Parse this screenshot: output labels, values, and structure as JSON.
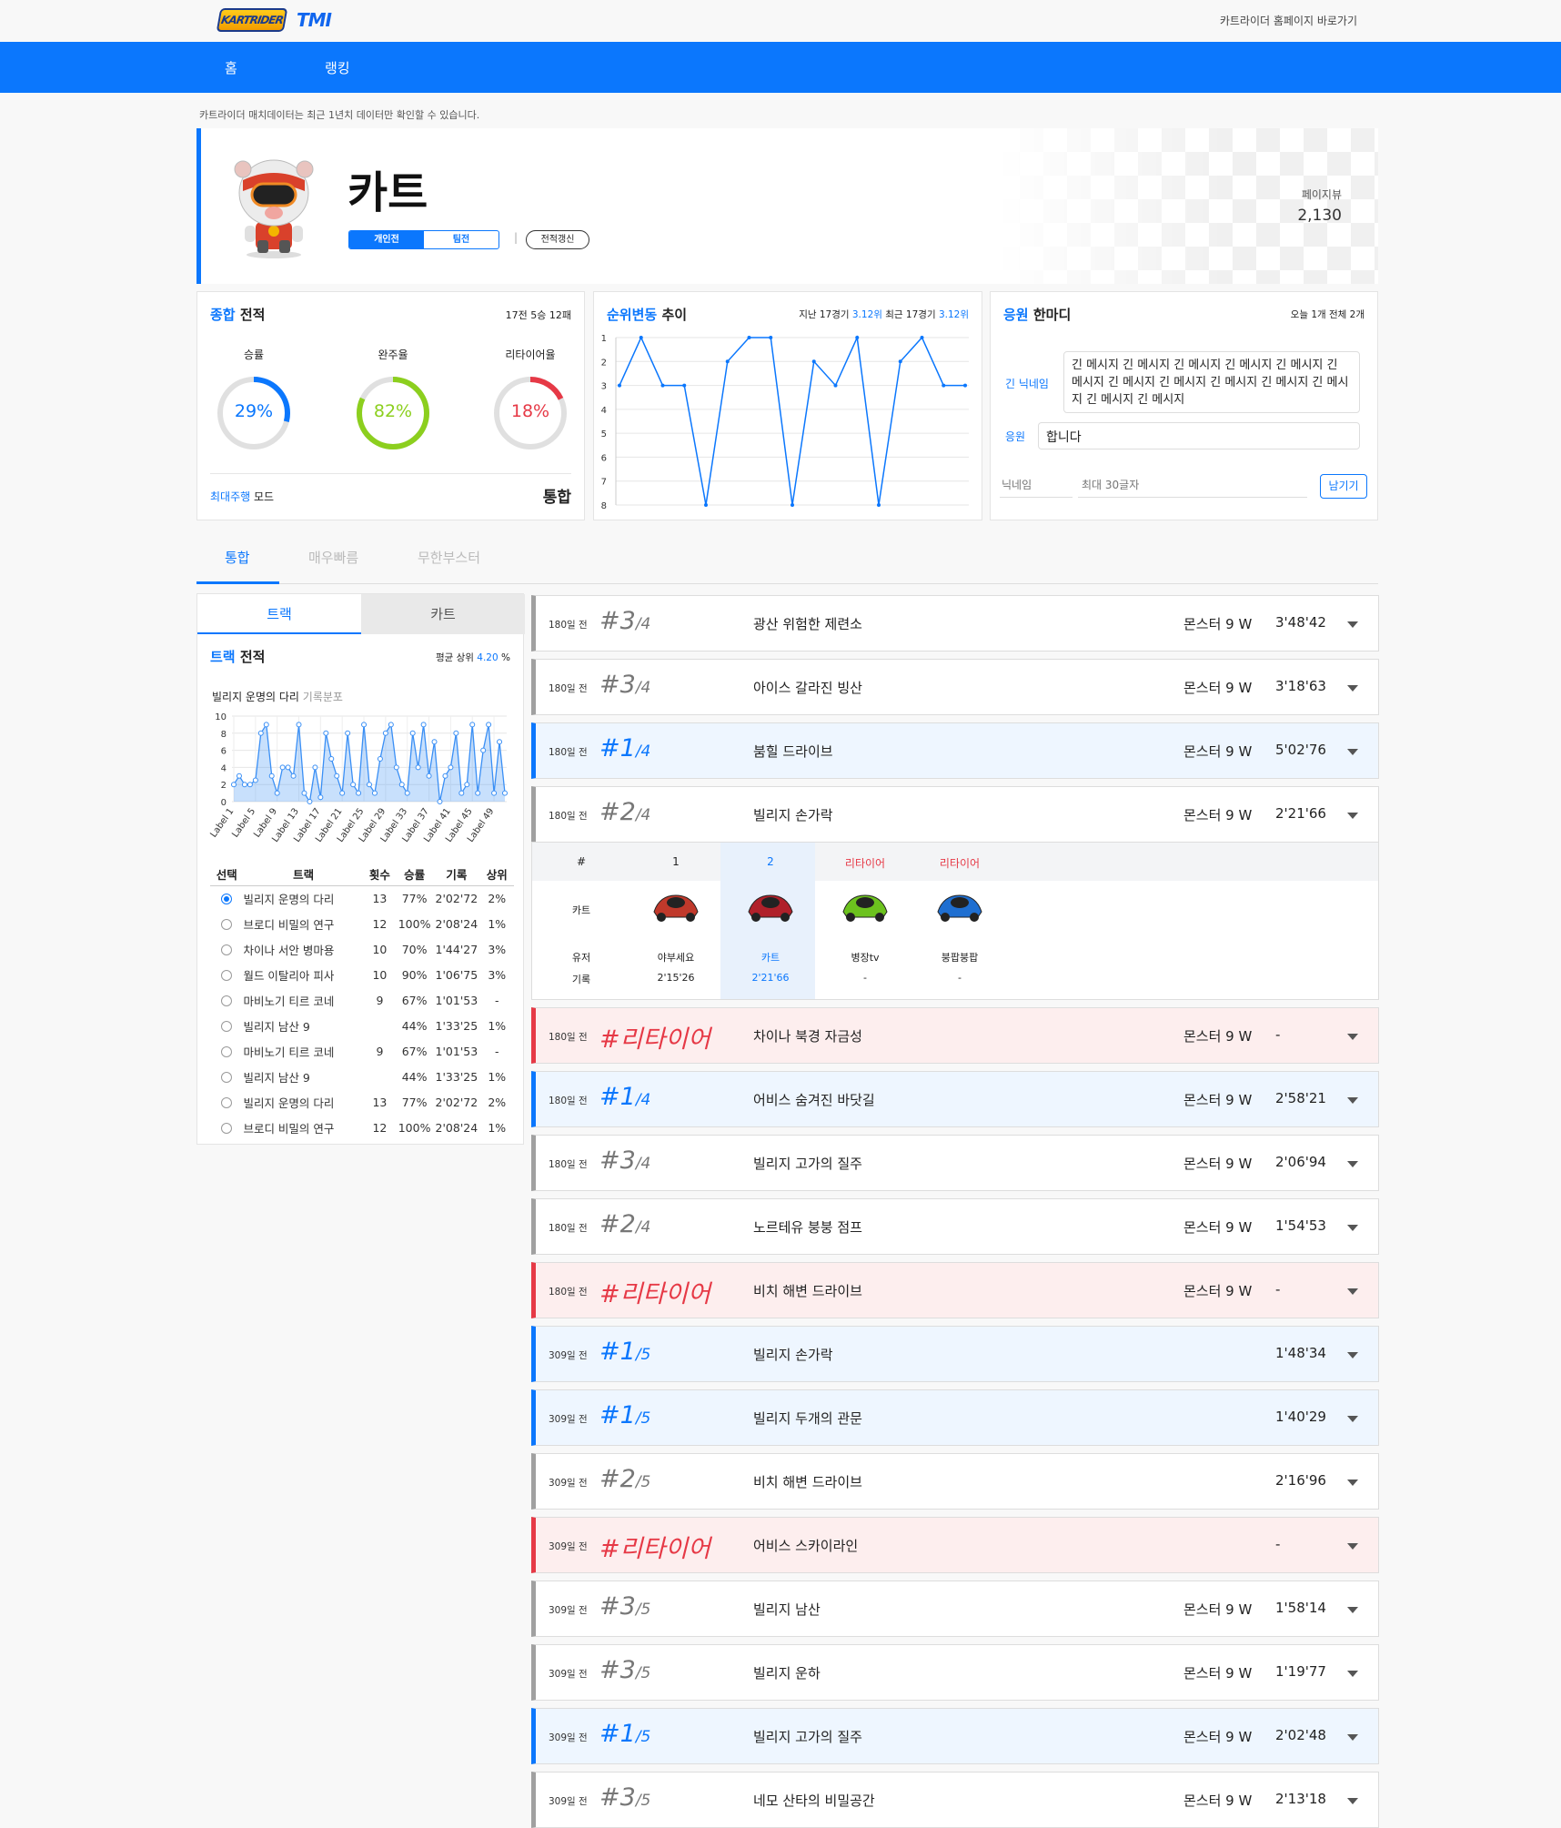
{
  "header": {
    "logo_brand": "KARTRIDER",
    "logo_tmi": "TMI",
    "home_link": "카트라이더 홈페이지 바로가기"
  },
  "nav": {
    "items": [
      "홈",
      "랭킹"
    ]
  },
  "notice": "카트라이더 매치데이터는 최근 1년치 데이터만 확인할 수 있습니다.",
  "profile": {
    "name": "카트",
    "mode_tabs": [
      "개인전",
      "팀전"
    ],
    "active_mode": "개인전",
    "refresh": "전적갱신",
    "pageview_label": "페이지뷰",
    "pageview": "2,130"
  },
  "summary": {
    "title_accent": "종합",
    "title": "전적",
    "record": "17전 5승 12패",
    "gauges": [
      {
        "label": "승률",
        "value": 29,
        "text": "29%",
        "color": "#0b77fd"
      },
      {
        "label": "완주율",
        "value": 82,
        "text": "82%",
        "color": "#8ccf1e"
      },
      {
        "label": "리타이어율",
        "value": 18,
        "text": "18%",
        "color": "#e63946"
      }
    ],
    "most_mode_accent": "최대주행",
    "most_mode_label": "모드",
    "most_mode_value": "통합"
  },
  "trend": {
    "title_accent": "순위변동",
    "title": "추이",
    "info_prefix": "지난 17경기",
    "info_avg": "3.12위",
    "info_mid": "최근 17경기",
    "info_recent": "3.12위",
    "y_ticks": [
      1,
      2,
      3,
      4,
      5,
      6,
      7,
      8
    ],
    "values": [
      3,
      1,
      3,
      3,
      8,
      2,
      1,
      1,
      8,
      2,
      3,
      1,
      8,
      2,
      1,
      3,
      3
    ],
    "color": "#0b77fd"
  },
  "cheer": {
    "title_accent": "응원",
    "title": "한마디",
    "info": "오늘 1개 전체 2개",
    "entries": [
      {
        "nick": "긴 닉네임",
        "msg": "긴 메시지 긴 메시지 긴 메시지 긴 메시지 긴 메시지 긴 메시지 긴 메시지 긴 메시지 긴 메시지 긴 메시지 긴 메시지 긴 메시지 긴 메시지"
      },
      {
        "nick": "응원",
        "msg": "합니다"
      }
    ],
    "nick_placeholder": "닉네임",
    "msg_placeholder": "최대 30글자",
    "submit": "남기기"
  },
  "main_tabs": {
    "items": [
      "통합",
      "매우빠름",
      "무한부스터"
    ],
    "active": "통합"
  },
  "side": {
    "tabs": [
      "트랙",
      "카트"
    ],
    "active": "트랙",
    "title_accent": "트랙",
    "title": "전적",
    "avg_label": "평균 상위",
    "avg_value": "4.20",
    "avg_unit": "%",
    "chart_title": "빌리지 운명의 다리",
    "chart_sub": "기록분포",
    "headers": [
      "선택",
      "트랙",
      "횟수",
      "승률",
      "기록",
      "상위"
    ],
    "rows": [
      {
        "name": "빌리지 운명의 다리",
        "count": "13",
        "win": "77%",
        "rec": "2'02'72",
        "top": "2%",
        "selected": true
      },
      {
        "name": "브로디 비밀의 연구",
        "count": "12",
        "win": "100%",
        "rec": "2'08'24",
        "top": "1%",
        "selected": false
      },
      {
        "name": "차이나 서안 병마용",
        "count": "10",
        "win": "70%",
        "rec": "1'44'27",
        "top": "3%",
        "selected": false
      },
      {
        "name": "월드 이탈리아 피사",
        "count": "10",
        "win": "90%",
        "rec": "1'06'75",
        "top": "3%",
        "selected": false
      },
      {
        "name": "마비노기 티르 코네",
        "count": "9",
        "win": "67%",
        "rec": "1'01'53",
        "top": "-",
        "selected": false
      },
      {
        "name": "빌리지 남산 9",
        "count": "",
        "win": "44%",
        "rec": "1'33'25",
        "top": "1%",
        "selected": false
      },
      {
        "name": "마비노기 티르 코네",
        "count": "9",
        "win": "67%",
        "rec": "1'01'53",
        "top": "-",
        "selected": false
      },
      {
        "name": "빌리지 남산 9",
        "count": "",
        "win": "44%",
        "rec": "1'33'25",
        "top": "1%",
        "selected": false
      },
      {
        "name": "빌리지 운명의 다리",
        "count": "13",
        "win": "77%",
        "rec": "2'02'72",
        "top": "2%",
        "selected": false
      },
      {
        "name": "브로디 비밀의 연구",
        "count": "12",
        "win": "100%",
        "rec": "2'08'24",
        "top": "1%",
        "selected": false
      }
    ]
  },
  "chart_data": {
    "type": "line",
    "title": "빌리지 운명의 다리",
    "subtitle": "기록분포",
    "ylim": [
      0,
      10
    ],
    "y_ticks": [
      0,
      2,
      4,
      6,
      8,
      10
    ],
    "x_tick_labels": [
      "Label 1",
      "Label 5",
      "Label 9",
      "Label 13",
      "Label 17",
      "Label 21",
      "Label 25",
      "Label 29",
      "Label 33",
      "Label 37",
      "Label 41",
      "Label 45",
      "Label 49"
    ],
    "series": [
      {
        "values": [
          2,
          3,
          2,
          2,
          2.5,
          8,
          9,
          3,
          1,
          4,
          4,
          3,
          9,
          1,
          0,
          4,
          0.5,
          8,
          5,
          3,
          1,
          8,
          2,
          1,
          9,
          2,
          1,
          5,
          8,
          9,
          4,
          2,
          1,
          8,
          4,
          9,
          3,
          7,
          0,
          3,
          4,
          8,
          1,
          2,
          9,
          1,
          6,
          9,
          1,
          7,
          1
        ]
      }
    ],
    "color": "#3a8ff5"
  },
  "matches": [
    {
      "ago": "180일 전",
      "rank": "#3",
      "total": "/4",
      "track": "광산 위험한 제련소",
      "kart": "몬스터 9 W",
      "time": "3'48'42",
      "type": "normal"
    },
    {
      "ago": "180일 전",
      "rank": "#3",
      "total": "/4",
      "track": "아이스 갈라진 빙산",
      "kart": "몬스터 9 W",
      "time": "3'18'63",
      "type": "normal"
    },
    {
      "ago": "180일 전",
      "rank": "#1",
      "total": "/4",
      "track": "붐힐 드라이브",
      "kart": "몬스터 9 W",
      "time": "5'02'76",
      "type": "win"
    },
    {
      "ago": "180일 전",
      "rank": "#2",
      "total": "/4",
      "track": "빌리지 손가락",
      "kart": "몬스터 9 W",
      "time": "2'21'66",
      "type": "normal"
    },
    {
      "ago": "180일 전",
      "rank": "#리타이어",
      "total": "",
      "track": "차이나 북경 자금성",
      "kart": "몬스터 9 W",
      "time": "-",
      "type": "ret"
    },
    {
      "ago": "180일 전",
      "rank": "#1",
      "total": "/4",
      "track": "어비스 숨겨진 바닷길",
      "kart": "몬스터 9 W",
      "time": "2'58'21",
      "type": "win"
    },
    {
      "ago": "180일 전",
      "rank": "#3",
      "total": "/4",
      "track": "빌리지 고가의 질주",
      "kart": "몬스터 9 W",
      "time": "2'06'94",
      "type": "normal"
    },
    {
      "ago": "180일 전",
      "rank": "#2",
      "total": "/4",
      "track": "노르테유 붕붕 점프",
      "kart": "몬스터 9 W",
      "time": "1'54'53",
      "type": "normal"
    },
    {
      "ago": "180일 전",
      "rank": "#리타이어",
      "total": "",
      "track": "비치 해변 드라이브",
      "kart": "몬스터 9 W",
      "time": "-",
      "type": "ret"
    },
    {
      "ago": "309일 전",
      "rank": "#1",
      "total": "/5",
      "track": "빌리지 손가락",
      "kart": "",
      "time": "1'48'34",
      "type": "win"
    },
    {
      "ago": "309일 전",
      "rank": "#1",
      "total": "/5",
      "track": "빌리지 두개의 관문",
      "kart": "",
      "time": "1'40'29",
      "type": "win"
    },
    {
      "ago": "309일 전",
      "rank": "#2",
      "total": "/5",
      "track": "비치 해변 드라이브",
      "kart": "",
      "time": "2'16'96",
      "type": "normal"
    },
    {
      "ago": "309일 전",
      "rank": "#리타이어",
      "total": "",
      "track": "어비스 스카이라인",
      "kart": "",
      "time": "-",
      "type": "ret"
    },
    {
      "ago": "309일 전",
      "rank": "#3",
      "total": "/5",
      "track": "빌리지 남산",
      "kart": "몬스터 9 W",
      "time": "1'58'14",
      "type": "normal"
    },
    {
      "ago": "309일 전",
      "rank": "#3",
      "total": "/5",
      "track": "빌리지 운하",
      "kart": "몬스터 9 W",
      "time": "1'19'77",
      "type": "normal"
    },
    {
      "ago": "309일 전",
      "rank": "#1",
      "total": "/5",
      "track": "빌리지 고가의 질주",
      "kart": "몬스터 9 W",
      "time": "2'02'48",
      "type": "win"
    },
    {
      "ago": "309일 전",
      "rank": "#3",
      "total": "/5",
      "track": "네모 산타의 비밀공간",
      "kart": "몬스터 9 W",
      "time": "2'13'18",
      "type": "normal"
    }
  ],
  "detail": {
    "header": [
      "#",
      "1",
      "2",
      "리타이어",
      "리타이어"
    ],
    "row_kart_label": "카트",
    "row_user_label": "유저",
    "row_rec_label": "기록",
    "players": [
      {
        "user": "야부세요",
        "rec": "2'15'26",
        "kart_color": "#c0392b",
        "highlight": false
      },
      {
        "user": "카트",
        "rec": "2'21'66",
        "kart_color": "#b0202a",
        "highlight": true
      },
      {
        "user": "병장tv",
        "rec": "-",
        "kart_color": "#6cc21e",
        "highlight": false
      },
      {
        "user": "붕팝붕팝",
        "rec": "-",
        "kart_color": "#1f6fd1",
        "highlight": false
      }
    ]
  }
}
